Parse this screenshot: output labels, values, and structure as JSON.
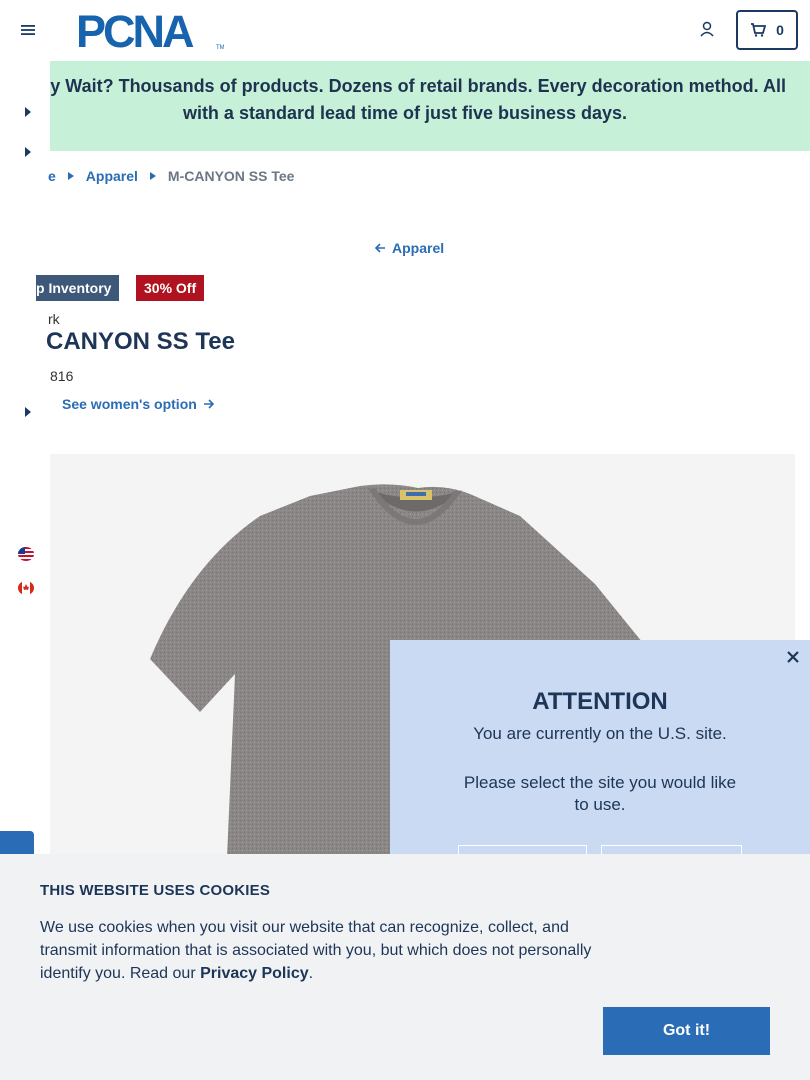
{
  "header": {
    "logo_text": "PCNA",
    "cart_count": "0"
  },
  "promo": {
    "line1": "y Wait? Thousands of products. Dozens of retail brands. Every decoration method. All",
    "line2": "with a standard lead time of just five business days."
  },
  "breadcrumb": {
    "home": "e",
    "category": "Apparel",
    "current": "M-CANYON SS Tee"
  },
  "back_link": "Apparel",
  "badges": {
    "inventory": "p Inventory",
    "discount": "30% Off"
  },
  "product": {
    "brand": "rk",
    "title": "CANYON SS Tee",
    "sku": "816",
    "womens_link": "See women's option"
  },
  "attention": {
    "title": "ATTENTION",
    "body1": "You are currently on the U.S. site.",
    "body2": "Please select the site you would like to use."
  },
  "cookie": {
    "title": "THIS WEBSITE USES COOKIES",
    "text_before": "We use cookies when you visit our website that can recognize, collect, and transmit information that is associated with you, but which does not personally identify you. Read our ",
    "link": "Privacy Policy",
    "text_after": ".",
    "button": "Got it!"
  },
  "colors": {
    "navy": "#1d3557",
    "link_blue": "#2a6cb5",
    "promo_green": "#c7f0d8",
    "discount_red": "#b0121f",
    "inventory_slate": "#3d5878",
    "attention_bg": "#c9daf2"
  },
  "icons": [
    "menu-icon",
    "user-icon",
    "cart-icon",
    "caret-right-icon",
    "arrow-left-icon",
    "arrow-right-icon",
    "close-icon",
    "us-flag-icon",
    "canada-flag-icon"
  ]
}
